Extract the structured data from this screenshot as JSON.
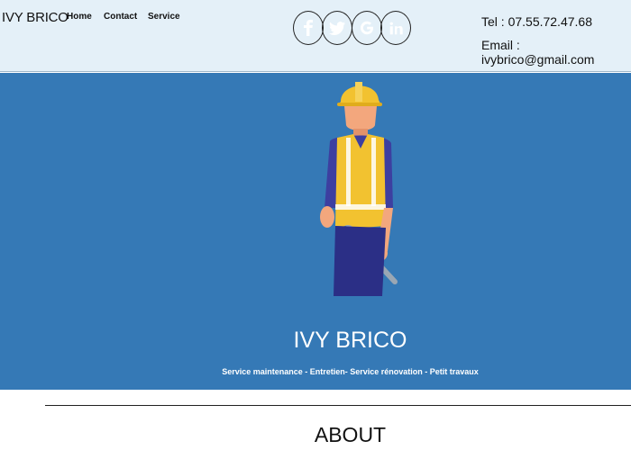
{
  "header": {
    "brand": "IVY BRICO",
    "nav": {
      "home": "Home",
      "contact": "Contact",
      "service": "Service"
    },
    "social": [
      {
        "icon": "facebook-icon",
        "glyph": "f"
      },
      {
        "icon": "twitter-icon",
        "glyph": "🐦"
      },
      {
        "icon": "google-icon",
        "glyph": "G"
      },
      {
        "icon": "linkedin-icon",
        "glyph": "in"
      }
    ],
    "tel": "Tel : 07.55.72.47.68",
    "email": "Email : ivybrico@gmail.com"
  },
  "hero": {
    "title": "IVY BRICO",
    "subtitle": "Service maintenance - Entretien- Service rénovation - Petit travaux"
  },
  "about": {
    "title": "ABOUT"
  },
  "colors": {
    "header_bg": "#e4f0f8",
    "hero_bg": "#3579b6",
    "helmet": "#f2c230",
    "vest": "#f2c230"
  }
}
